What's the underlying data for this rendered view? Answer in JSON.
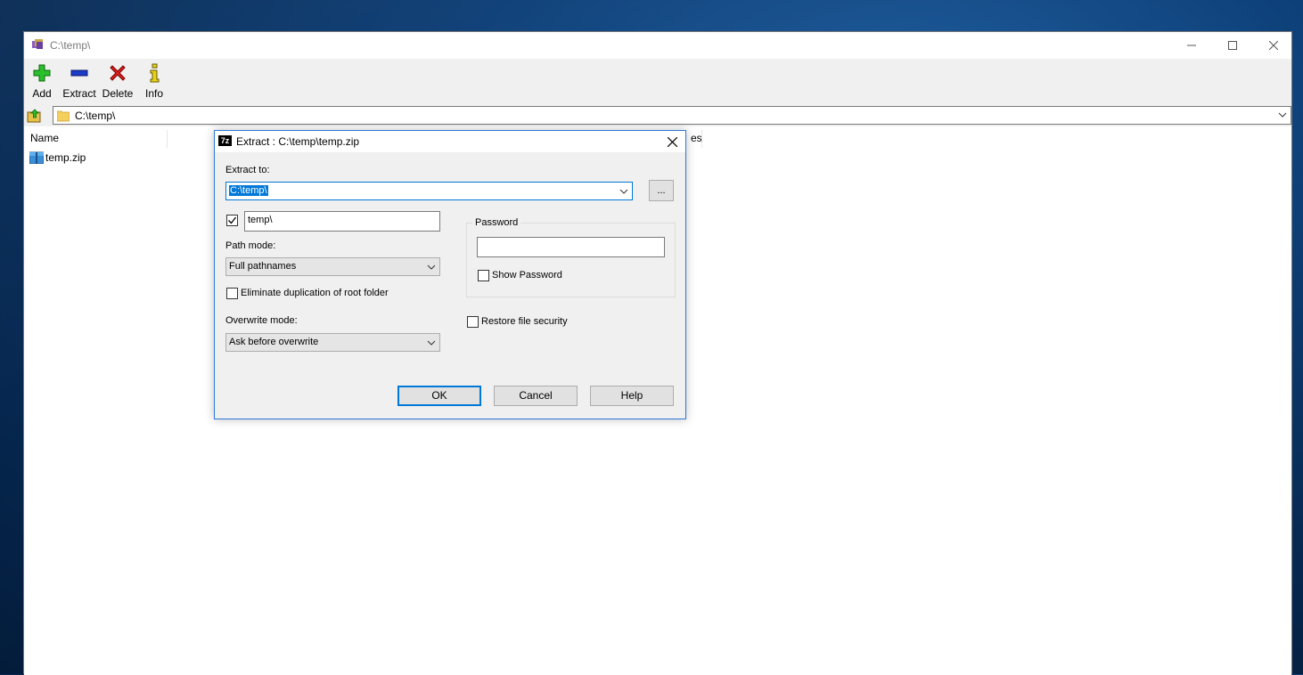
{
  "window": {
    "title": "C:\\temp\\"
  },
  "toolbar": {
    "add_label": "Add",
    "extract_label": "Extract",
    "delete_label": "Delete",
    "info_label": "Info"
  },
  "address": {
    "path": "C:\\temp\\"
  },
  "filelist": {
    "columns": [
      "Name",
      "es"
    ],
    "files": [
      {
        "name": "temp.zip",
        "icon": "zip-archive-icon"
      }
    ]
  },
  "dialog": {
    "title": "Extract : C:\\temp\\temp.zip",
    "extract_to_label": "Extract to:",
    "extract_to_value": "C:\\temp\\",
    "browse_label": "...",
    "subfolder_checked": true,
    "subfolder_value": "temp\\",
    "path_mode_label": "Path mode:",
    "path_mode_value": "Full pathnames",
    "eliminate_dup_label": "Eliminate duplication of root folder",
    "eliminate_dup_checked": false,
    "overwrite_mode_label": "Overwrite mode:",
    "overwrite_mode_value": "Ask before overwrite",
    "password_group_label": "Password",
    "password_value": "",
    "show_password_label": "Show Password",
    "show_password_checked": false,
    "restore_security_label": "Restore file security",
    "restore_security_checked": false,
    "ok_label": "OK",
    "cancel_label": "Cancel",
    "help_label": "Help"
  },
  "colors": {
    "accent": "#0078d7",
    "dialog_bg": "#f0f0f0",
    "desktop": "#0d3f78"
  }
}
